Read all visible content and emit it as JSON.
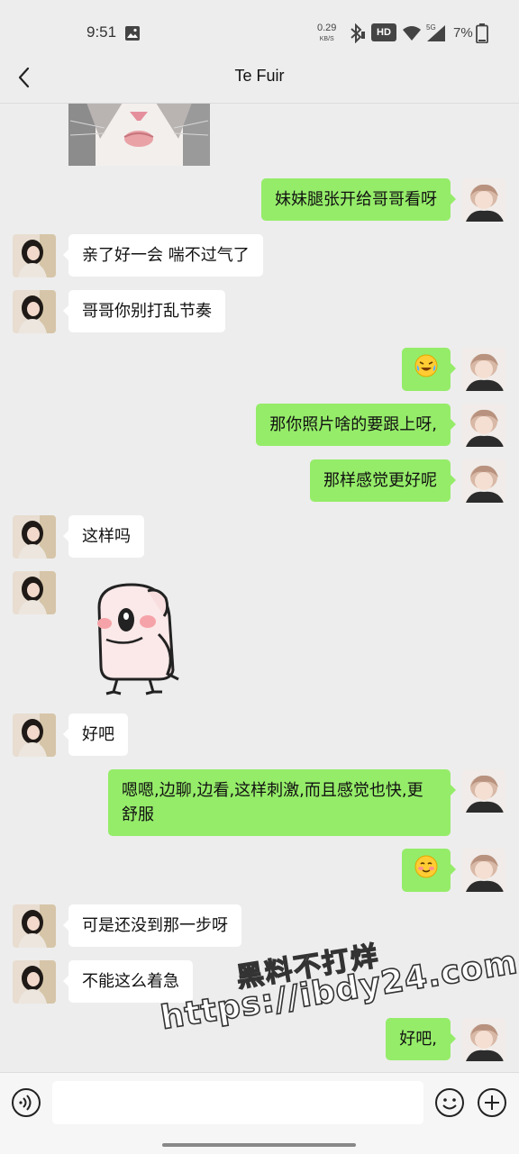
{
  "status_bar": {
    "time": "9:51",
    "net_speed_value": "0.29",
    "net_speed_unit": "KB/S",
    "hd_label": "HD",
    "network_type": "5G",
    "battery_percent": "7%"
  },
  "header": {
    "title": "Te Fuir"
  },
  "messages": [
    {
      "side": "left",
      "type": "image",
      "icon": "cat-photo"
    },
    {
      "side": "right",
      "type": "text",
      "text": "妹妹腿张开给哥哥看呀"
    },
    {
      "side": "left",
      "type": "text",
      "text": "亲了好一会 喘不过气了"
    },
    {
      "side": "left",
      "type": "text",
      "text": "哥哥你别打乱节奏"
    },
    {
      "side": "right",
      "type": "emoji",
      "icon": "laughing-crying-emoji"
    },
    {
      "side": "right",
      "type": "text",
      "text": "那你照片啥的要跟上呀,"
    },
    {
      "side": "right",
      "type": "text",
      "text": "那样感觉更好呢"
    },
    {
      "side": "left",
      "type": "text",
      "text": "这样吗"
    },
    {
      "side": "left",
      "type": "sticker",
      "icon": "parrot-sticker"
    },
    {
      "side": "left",
      "type": "text",
      "text": "好吧"
    },
    {
      "side": "right",
      "type": "text",
      "text": "嗯嗯,边聊,边看,这样刺激,而且感觉也快,更舒服"
    },
    {
      "side": "right",
      "type": "emoji",
      "icon": "blushing-smile-emoji"
    },
    {
      "side": "left",
      "type": "text",
      "text": "可是还没到那一步呀"
    },
    {
      "side": "left",
      "type": "text",
      "text": "不能这么着急"
    },
    {
      "side": "right",
      "type": "text",
      "text": "好吧,"
    }
  ],
  "watermark": {
    "line1": "黑料不打烊",
    "line2": "https://ibdy24.com"
  },
  "input_bar": {
    "placeholder": "",
    "icons": [
      "voice-icon",
      "emoji-icon",
      "plus-icon"
    ]
  },
  "colors": {
    "background": "#ededed",
    "sent_bubble": "#95ec69",
    "received_bubble": "#ffffff"
  }
}
